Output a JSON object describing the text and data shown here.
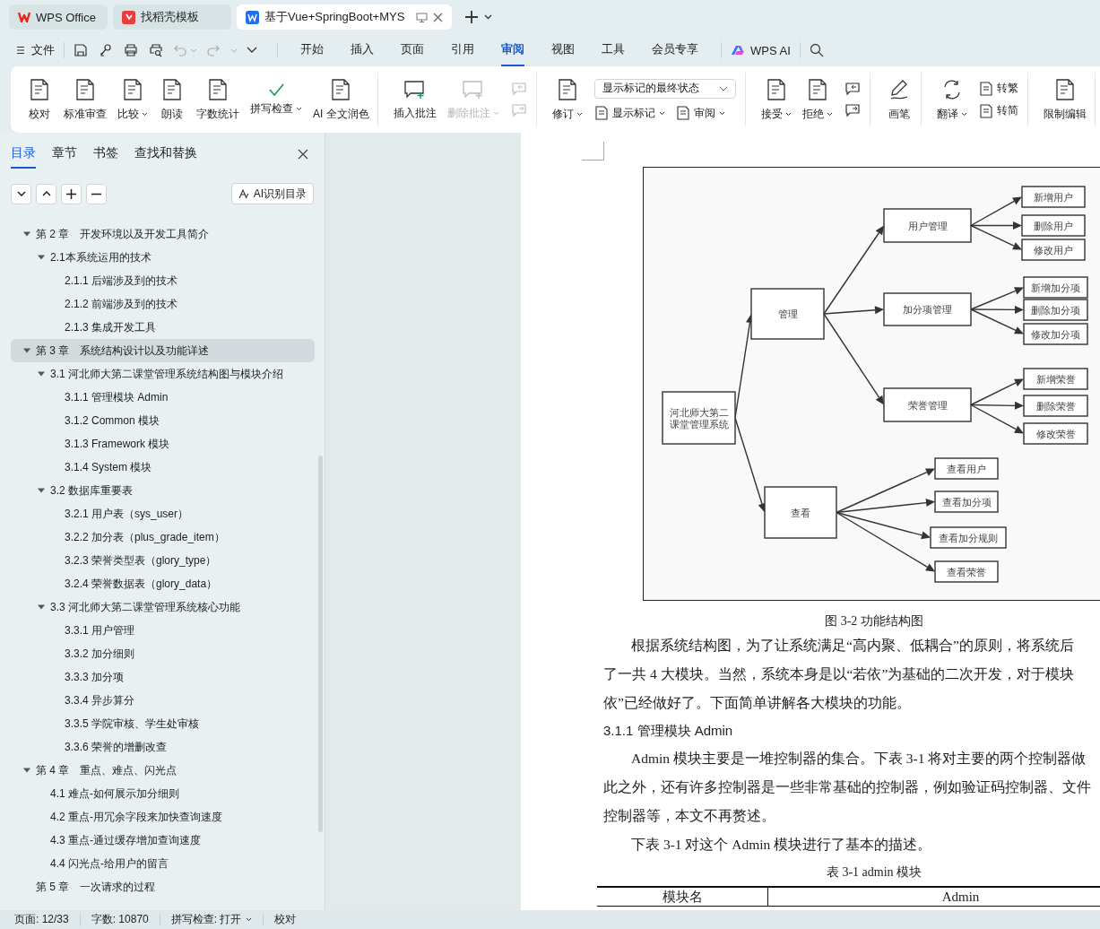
{
  "tabs": [
    {
      "kind": "home",
      "label": "WPS Office",
      "selected": false
    },
    {
      "kind": "template",
      "label": "找稻壳模板",
      "selected": false
    },
    {
      "kind": "document",
      "label": "基于Vue+SpringBoot+MYS",
      "selected": true
    }
  ],
  "menu": {
    "file": "文件",
    "tabs": [
      {
        "label": "开始",
        "selected": false
      },
      {
        "label": "插入",
        "selected": false
      },
      {
        "label": "页面",
        "selected": false
      },
      {
        "label": "引用",
        "selected": false
      },
      {
        "label": "审阅",
        "selected": true
      },
      {
        "label": "视图",
        "selected": false
      },
      {
        "label": "工具",
        "selected": false
      },
      {
        "label": "会员专享",
        "selected": false
      }
    ],
    "ai": "WPS AI"
  },
  "ribbon": {
    "groups": [
      {
        "items": [
          {
            "kind": "large",
            "label": "校对",
            "dropdown": false,
            "disabled": false
          },
          {
            "kind": "large",
            "label": "标准审查",
            "dropdown": false,
            "disabled": false
          },
          {
            "kind": "large",
            "label": "比较",
            "dropdown": true,
            "disabled": false
          },
          {
            "kind": "large",
            "label": "朗读",
            "dropdown": false,
            "disabled": false
          },
          {
            "kind": "large",
            "label": "字数统计",
            "dropdown": false,
            "disabled": false
          },
          {
            "kind": "large",
            "label": "拼写检查",
            "dropdown": true,
            "disabled": false
          },
          {
            "kind": "large",
            "label": "AI 全文润色",
            "dropdown": false,
            "disabled": false
          }
        ]
      },
      {
        "items": [
          {
            "kind": "large",
            "label": "插入批注",
            "dropdown": false,
            "disabled": false
          },
          {
            "kind": "large",
            "label": "删除批注",
            "dropdown": true,
            "disabled": true
          },
          {
            "kind": "stack",
            "items": [
              {
                "kind": "icon",
                "disabled": true
              },
              {
                "kind": "icon",
                "disabled": true
              }
            ]
          }
        ]
      },
      {
        "items": [
          {
            "kind": "large",
            "label": "修订",
            "dropdown": true,
            "disabled": false
          },
          {
            "kind": "stack",
            "items": [
              {
                "kind": "select",
                "value": "显示标记的最终状态"
              },
              {
                "kind": "row",
                "items": [
                  {
                    "kind": "small",
                    "label": "显示标记",
                    "dropdown": true,
                    "disabled": false
                  },
                  {
                    "kind": "small",
                    "label": "审阅",
                    "dropdown": true,
                    "disabled": false
                  }
                ]
              }
            ]
          }
        ]
      },
      {
        "items": [
          {
            "kind": "large",
            "label": "接受",
            "dropdown": true,
            "disabled": false
          },
          {
            "kind": "large",
            "label": "拒绝",
            "dropdown": true,
            "disabled": false
          },
          {
            "kind": "stack",
            "items": [
              {
                "kind": "icon",
                "disabled": false
              },
              {
                "kind": "icon",
                "disabled": false
              }
            ]
          }
        ]
      },
      {
        "items": [
          {
            "kind": "large",
            "label": "画笔",
            "dropdown": false,
            "disabled": false
          }
        ]
      },
      {
        "items": [
          {
            "kind": "large",
            "label": "翻译",
            "dropdown": true,
            "disabled": false
          },
          {
            "kind": "stack",
            "items": [
              {
                "kind": "small",
                "label": "转繁",
                "dropdown": false,
                "disabled": false
              },
              {
                "kind": "small",
                "label": "转简",
                "dropdown": false,
                "disabled": false
              }
            ]
          }
        ]
      },
      {
        "items": [
          {
            "kind": "large",
            "label": "限制编辑",
            "dropdown": false,
            "disabled": false
          }
        ]
      }
    ]
  },
  "sidebar": {
    "tabs": [
      {
        "label": "目录",
        "selected": true
      },
      {
        "label": "章节",
        "selected": false
      },
      {
        "label": "书签",
        "selected": false
      },
      {
        "label": "查找和替换",
        "selected": false
      }
    ],
    "ai_button": "AI识别目录",
    "toc": [
      {
        "label": "第 2 章　开发环境以及开发工具简介",
        "expanded": true,
        "selected": false,
        "children": [
          {
            "label": "2.1本系统运用的技术",
            "expanded": true,
            "selected": false,
            "children": [
              {
                "label": "2.1.1  后端涉及到的技术",
                "selected": false
              },
              {
                "label": "2.1.2  前端涉及到的技术",
                "selected": false
              },
              {
                "label": "2.1.3  集成开发工具",
                "selected": false
              }
            ]
          }
        ]
      },
      {
        "label": "第 3 章　系统结构设计以及功能详述",
        "expanded": true,
        "selected": true,
        "children": [
          {
            "label": "3.1  河北师大第二课堂管理系统结构图与模块介绍",
            "expanded": true,
            "selected": false,
            "children": [
              {
                "label": "3.1.1  管理模块 Admin",
                "selected": false
              },
              {
                "label": "3.1.2 Common 模块",
                "selected": false
              },
              {
                "label": "3.1.3 Framework 模块",
                "selected": false
              },
              {
                "label": "3.1.4 System 模块",
                "selected": false
              }
            ]
          },
          {
            "label": "3.2  数据库重要表",
            "expanded": true,
            "selected": false,
            "children": [
              {
                "label": "3.2.1  用户表（sys_user）",
                "selected": false
              },
              {
                "label": "3.2.2  加分表（plus_grade_item）",
                "selected": false
              },
              {
                "label": "3.2.3  荣誉类型表（glory_type）",
                "selected": false
              },
              {
                "label": "3.2.4  荣誉数据表（glory_data）",
                "selected": false
              }
            ]
          },
          {
            "label": "3.3  河北师大第二课堂管理系统核心功能",
            "expanded": true,
            "selected": false,
            "children": [
              {
                "label": "3.3.1  用户管理",
                "selected": false
              },
              {
                "label": "3.3.2  加分细则",
                "selected": false
              },
              {
                "label": "3.3.3  加分项",
                "selected": false
              },
              {
                "label": "3.3.4  异步算分",
                "selected": false
              },
              {
                "label": "3.3.5  学院审核、学生处审核",
                "selected": false
              },
              {
                "label": "3.3.6  荣誉的增删改查",
                "selected": false
              }
            ]
          }
        ]
      },
      {
        "label": "第 4 章　重点、难点、闪光点",
        "expanded": true,
        "selected": false,
        "children": [
          {
            "label": "4.1  难点-如何展示加分细则",
            "selected": false
          },
          {
            "label": "4.2  重点-用冗余字段来加快查询速度",
            "selected": false
          },
          {
            "label": "4.3  重点-通过缓存增加查询速度",
            "selected": false
          },
          {
            "label": "4.4  闪光点-给用户的留言",
            "selected": false
          }
        ]
      },
      {
        "label": "第 5 章　一次请求的过程",
        "selected": false
      }
    ]
  },
  "document": {
    "figure": {
      "root": {
        "label": "河北师大第二课堂管理系统",
        "children": [
          {
            "label": "管理",
            "children": [
              {
                "label": "用户管理",
                "children": [
                  {
                    "label": "新增用户"
                  },
                  {
                    "label": "删除用户"
                  },
                  {
                    "label": "修改用户"
                  }
                ]
              },
              {
                "label": "加分项管理",
                "children": [
                  {
                    "label": "新增加分项"
                  },
                  {
                    "label": "删除加分项"
                  },
                  {
                    "label": "修改加分项"
                  }
                ]
              },
              {
                "label": "荣誉管理",
                "children": [
                  {
                    "label": "新增荣誉"
                  },
                  {
                    "label": "删除荣誉"
                  },
                  {
                    "label": "修改荣誉"
                  }
                ]
              }
            ]
          },
          {
            "label": "查看",
            "children": [
              {
                "label": "查看用户"
              },
              {
                "label": "查看加分项"
              },
              {
                "label": "查看加分规则"
              },
              {
                "label": "查看荣誉"
              }
            ]
          }
        ]
      },
      "caption": "图 3-2 功能结构图"
    },
    "blocks": [
      {
        "kind": "paragraph",
        "lines": [
          "根据系统结构图，为了让系统满足“高内聚、低耦合”的原则，将系统后",
          "了一共 4 大模块。当然，系统本身是以“若依”为基础的二次开发，对于模块",
          "依”已经做好了。下面简单讲解各大模块的功能。"
        ]
      },
      {
        "kind": "heading",
        "text": "3.1.1  管理模块 Admin"
      },
      {
        "kind": "paragraph",
        "lines": [
          "Admin 模块主要是一堆控制器的集合。下表 3-1 将对主要的两个控制器做",
          "此之外，还有许多控制器是一些非常基础的控制器，例如验证码控制器、文件",
          "控制器等，本文不再赘述。"
        ]
      },
      {
        "kind": "paragraph",
        "lines": [
          "下表 3-1 对这个 Admin 模块进行了基本的描述。"
        ]
      },
      {
        "kind": "caption",
        "text": "表 3-1 admin 模块"
      }
    ],
    "table": {
      "rows": [
        [
          "模块名",
          "Admin"
        ]
      ]
    }
  },
  "status_bar": [
    {
      "label": "页面: 12/33",
      "dropdown": false
    },
    {
      "label": "字数: 10870",
      "dropdown": false
    },
    {
      "label": "拼写检查: 打开",
      "dropdown": true
    },
    {
      "label": "校对",
      "dropdown": false
    }
  ]
}
